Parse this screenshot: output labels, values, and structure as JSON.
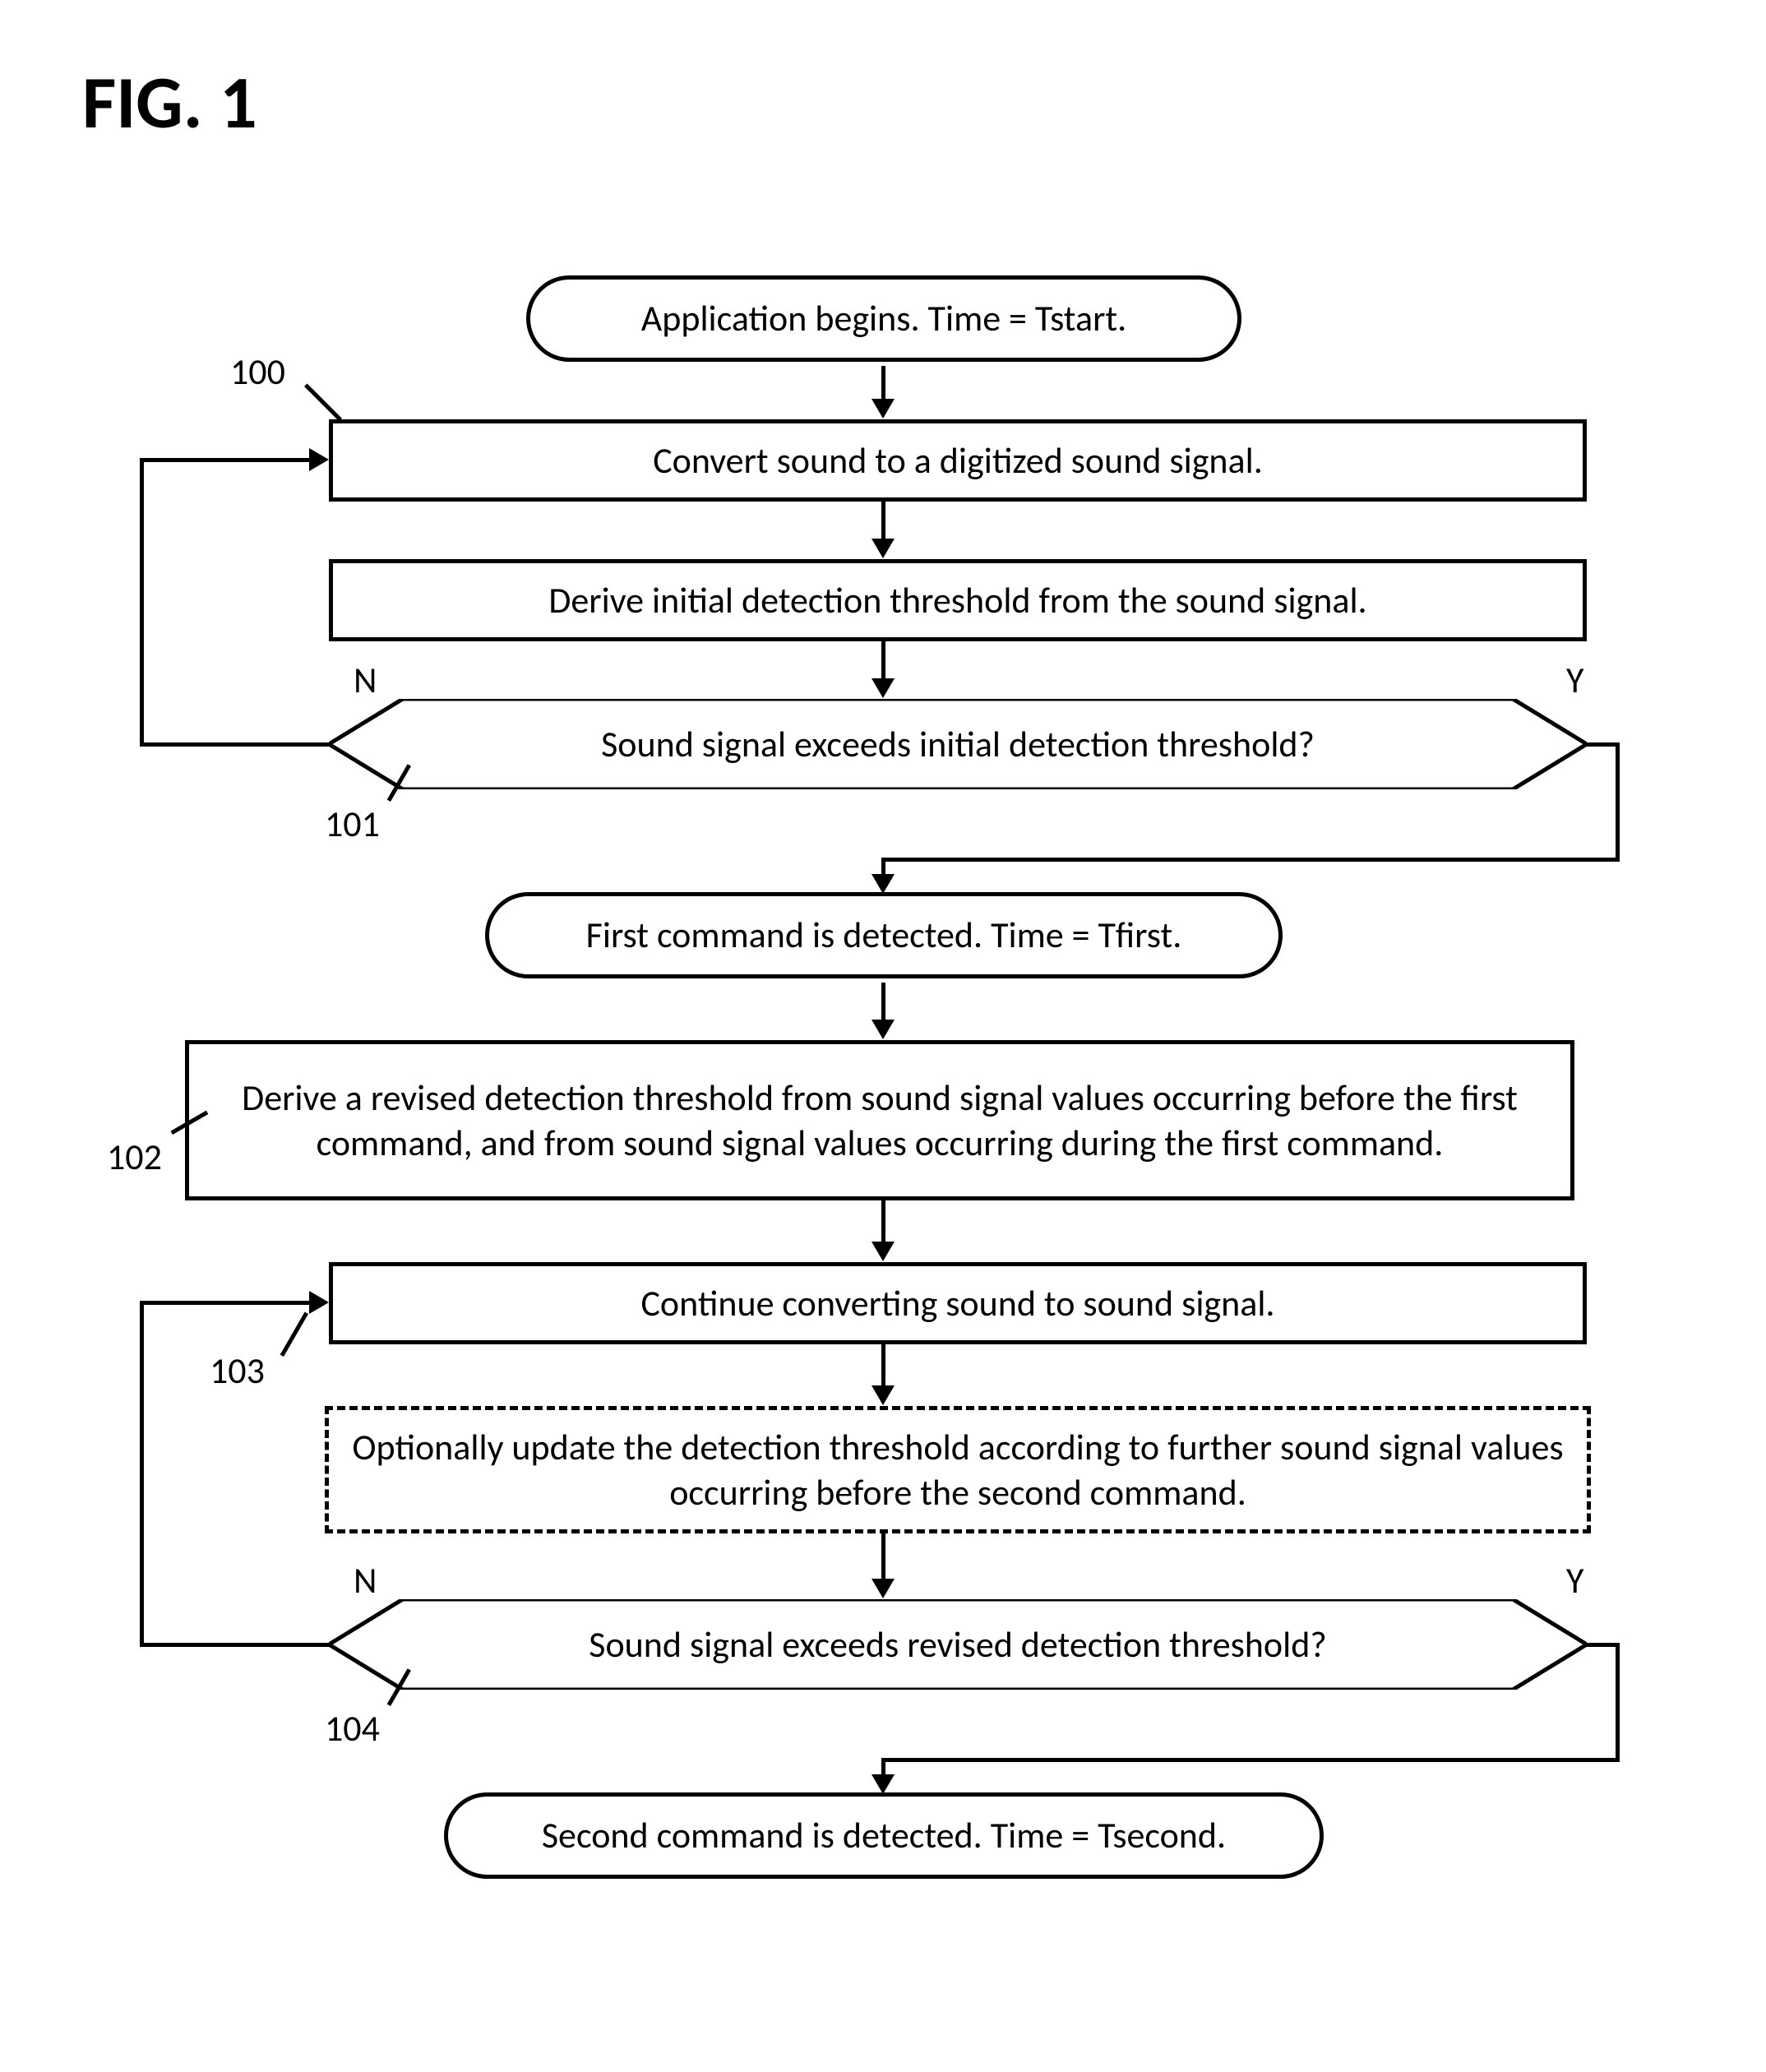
{
  "figure_title": "FIG. 1",
  "nodes": {
    "start": {
      "text": "Application begins.  Time = Tstart."
    },
    "convert": {
      "text": "Convert sound to a digitized sound signal."
    },
    "derive1": {
      "text": "Derive initial detection threshold from the sound signal."
    },
    "dec1": {
      "text": "Sound signal exceeds initial detection threshold?"
    },
    "detected1": {
      "text": "First command is detected.  Time = Tfirst."
    },
    "derive2": {
      "text": "Derive a revised detection threshold from sound signal values occurring before the first command, and from sound signal values occurring during the first command."
    },
    "continue": {
      "text": "Continue converting sound to sound signal."
    },
    "optional": {
      "text": "Optionally update the detection threshold according to further sound signal values occurring before the second command."
    },
    "dec2": {
      "text": "Sound signal exceeds revised detection threshold?"
    },
    "detected2": {
      "text": "Second command is detected.  Time = Tsecond."
    }
  },
  "refs": {
    "r100": "100",
    "r101": "101",
    "r102": "102",
    "r103": "103",
    "r104": "104"
  },
  "branches": {
    "no": "N",
    "yes": "Y"
  },
  "chart_data": {
    "type": "flowchart",
    "nodes": [
      {
        "id": "start",
        "kind": "terminator",
        "label": "Application begins.  Time = Tstart."
      },
      {
        "id": "convert",
        "kind": "process",
        "label": "Convert sound to a digitized sound signal.",
        "ref": "100"
      },
      {
        "id": "derive1",
        "kind": "process",
        "label": "Derive initial detection threshold from the sound signal."
      },
      {
        "id": "dec1",
        "kind": "decision",
        "label": "Sound signal exceeds initial detection threshold?",
        "ref": "101"
      },
      {
        "id": "detected1",
        "kind": "terminator",
        "label": "First command is detected.  Time = Tfirst."
      },
      {
        "id": "derive2",
        "kind": "process",
        "label": "Derive a revised detection threshold from sound signal values occurring before the first command, and from sound signal values occurring during the first command.",
        "ref": "102"
      },
      {
        "id": "continue",
        "kind": "process",
        "label": "Continue converting sound to sound signal.",
        "ref": "103"
      },
      {
        "id": "optional",
        "kind": "process-optional",
        "label": "Optionally update the detection threshold according to further sound signal values occurring before the second command."
      },
      {
        "id": "dec2",
        "kind": "decision",
        "label": "Sound signal exceeds revised detection threshold?",
        "ref": "104"
      },
      {
        "id": "detected2",
        "kind": "terminator",
        "label": "Second command is detected.  Time = Tsecond."
      }
    ],
    "edges": [
      {
        "from": "start",
        "to": "convert"
      },
      {
        "from": "convert",
        "to": "derive1"
      },
      {
        "from": "derive1",
        "to": "dec1"
      },
      {
        "from": "dec1",
        "to": "convert",
        "label": "N"
      },
      {
        "from": "dec1",
        "to": "detected1",
        "label": "Y"
      },
      {
        "from": "detected1",
        "to": "derive2"
      },
      {
        "from": "derive2",
        "to": "continue"
      },
      {
        "from": "continue",
        "to": "optional"
      },
      {
        "from": "optional",
        "to": "dec2"
      },
      {
        "from": "dec2",
        "to": "continue",
        "label": "N"
      },
      {
        "from": "dec2",
        "to": "detected2",
        "label": "Y"
      }
    ]
  }
}
